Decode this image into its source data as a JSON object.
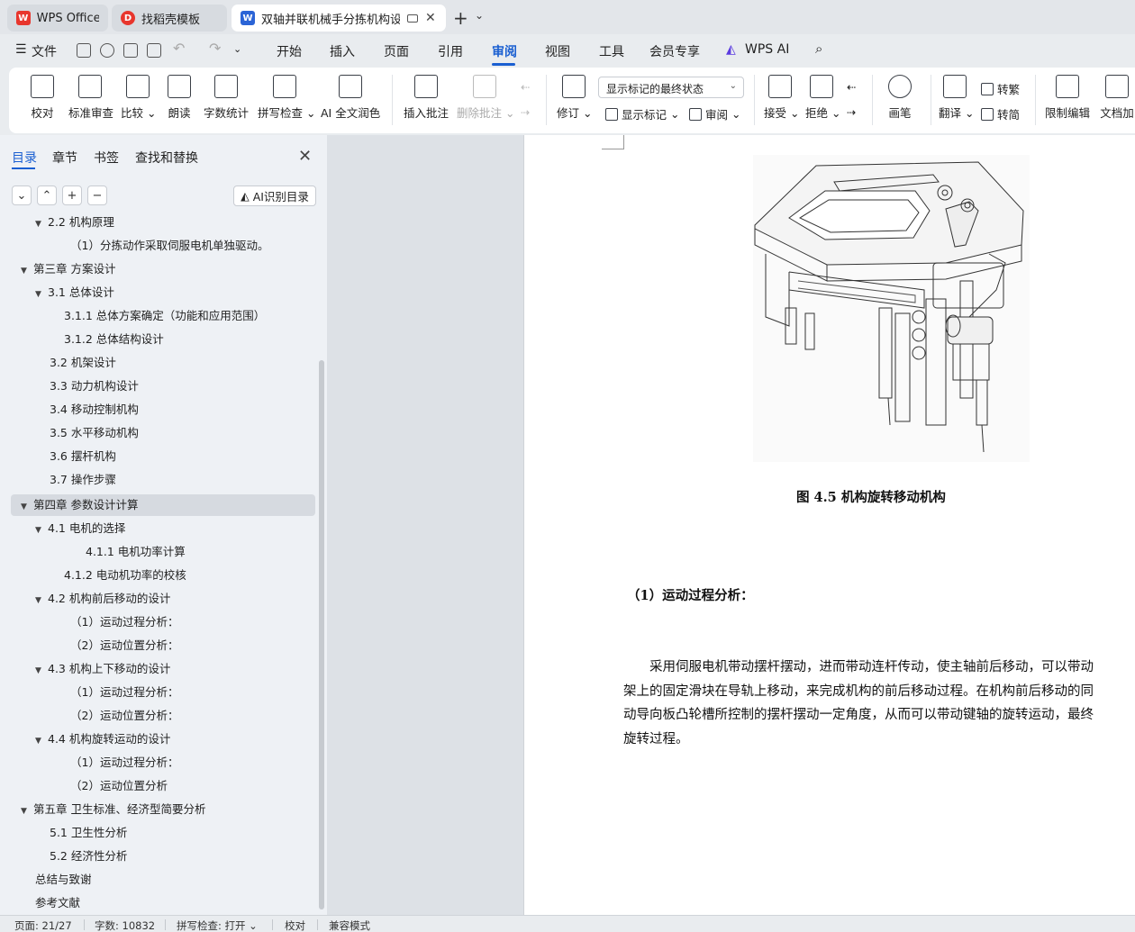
{
  "tabs": [
    {
      "label": "WPS Office",
      "icon": "wps-logo-icon"
    },
    {
      "label": "找稻壳模板",
      "icon": "docer-icon"
    },
    {
      "label": "双轴并联机械手分拣机构设计",
      "icon": "word-doc-icon"
    }
  ],
  "menu": {
    "file": "文件",
    "items": [
      "开始",
      "插入",
      "页面",
      "引用",
      "审阅",
      "视图",
      "工具",
      "会员专享"
    ],
    "active": "审阅",
    "wps_ai": "WPS AI"
  },
  "ribbon": {
    "proofread": "校对",
    "standard_review": "标准审查",
    "compare": "比较",
    "read_aloud": "朗读",
    "word_count": "字数统计",
    "spell_check": "拼写检查",
    "ai_polish": "AI 全文润色",
    "insert_comment": "插入批注",
    "delete_comment": "删除批注",
    "markup_dropdown": "显示标记的最终状态",
    "track_changes": "修订",
    "show_markup": "显示标记",
    "review_pane": "审阅",
    "accept": "接受",
    "reject": "拒绝",
    "pen": "画笔",
    "translate": "翻译",
    "to_traditional": "转繁",
    "to_simplified": "转简",
    "restrict_edit": "限制编辑",
    "doc_encrypt": "文档加"
  },
  "nav": {
    "tabs": [
      "目录",
      "章节",
      "书签",
      "查找和替换"
    ],
    "ai_toc": "AI识别目录",
    "toc": [
      "2.2  机构原理",
      "（1）分拣动作采取伺服电机单独驱动。",
      "第三章   方案设计",
      "3.1    总体设计",
      "3.1.1  总体方案确定（功能和应用范围）",
      "3.1.2  总体结构设计",
      "3.2    机架设计",
      "3.3    动力机构设计",
      "3.4    移动控制机构",
      "3.5    水平移动机构",
      "3.6    摆杆机构",
      "3.7    操作步骤",
      "第四章  参数设计计算",
      "4.1  电机的选择",
      "4.1.1  电机功率计算",
      "4.1.2  电动机功率的校核",
      "4.2    机构前后移动的设计",
      "（1）运动过程分析：",
      "（2）运动位置分析：",
      "4.3    机构上下移动的设计",
      "（1）运动过程分析：",
      "（2）运动位置分析：",
      "4.4  机构旋转运动的设计",
      "（1）运动过程分析：",
      "（2）运动位置分析",
      "第五章   卫生标准、经济型简要分析",
      "5.1  卫生性分析",
      "5.2  经济性分析",
      "总结与致谢",
      "参考文献"
    ]
  },
  "document": {
    "caption": "图 4.5  机构旋转移动机构",
    "subheading": "（1）运动过程分析：",
    "paragraph_lines": [
      "　　采用伺服电机带动摆杆摆动，进而带动连杆传动，使主轴前后移动，可以带动",
      "架上的固定滑块在导轨上移动，来完成机构的前后移动过程。在机构前后移动的同",
      "动导向板凸轮槽所控制的摆杆摆动一定角度，从而可以带动键轴的旋转运动，最终",
      "旋转过程。"
    ]
  },
  "status": {
    "page": "页面: 21/27",
    "words": "字数: 10832",
    "spell": "拼写检查: 打开",
    "proof": "校对",
    "compat": "兼容模式"
  }
}
